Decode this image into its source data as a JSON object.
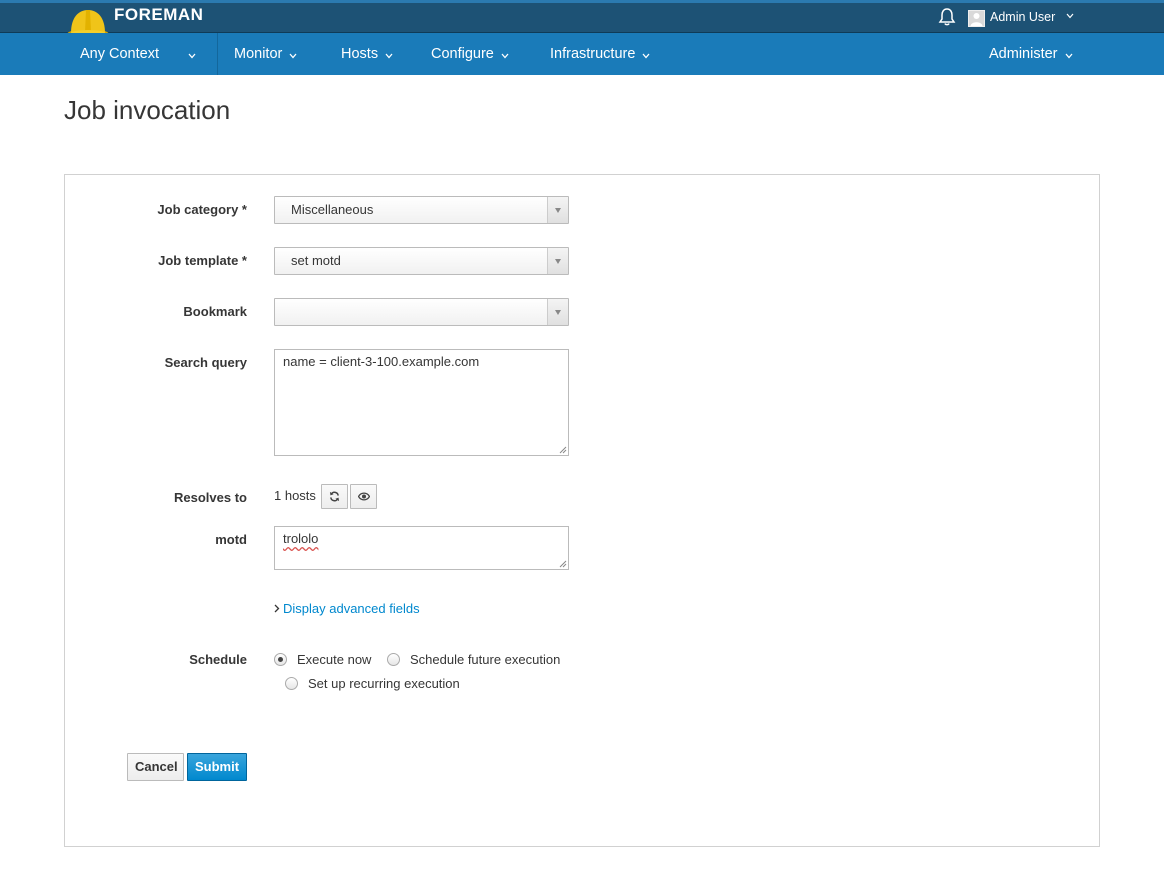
{
  "header": {
    "brand": "FOREMAN",
    "user_name": "Admin User"
  },
  "nav": {
    "context": "Any Context",
    "items": [
      "Monitor",
      "Hosts",
      "Configure",
      "Infrastructure"
    ],
    "right_item": "Administer"
  },
  "page": {
    "title": "Job invocation"
  },
  "form": {
    "job_category": {
      "label": "Job category *",
      "value": "Miscellaneous"
    },
    "job_template": {
      "label": "Job template *",
      "value": "set motd"
    },
    "bookmark": {
      "label": "Bookmark",
      "value": ""
    },
    "search_query": {
      "label": "Search query",
      "value": "name = client-3-100.example.com"
    },
    "resolves_to": {
      "label": "Resolves to",
      "value": "1 hosts"
    },
    "motd": {
      "label": "motd",
      "value": "trololo"
    },
    "advanced_link": "Display advanced fields",
    "schedule": {
      "label": "Schedule",
      "options": [
        "Execute now",
        "Schedule future execution",
        "Set up recurring execution"
      ],
      "selected": "Execute now"
    },
    "buttons": {
      "cancel": "Cancel",
      "submit": "Submit"
    }
  },
  "colors": {
    "topbar": "#1d5275",
    "navbar": "#1a7bb9",
    "link": "#0088ce",
    "primary_button": "#0088ce"
  }
}
